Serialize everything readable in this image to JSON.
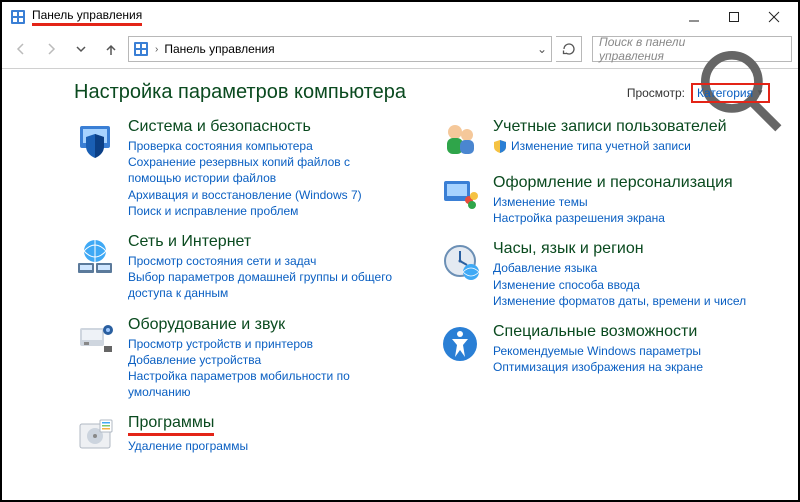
{
  "window": {
    "title": "Панель управления"
  },
  "breadcrumb": {
    "label": "Панель управления"
  },
  "search": {
    "placeholder": "Поиск в панели управления"
  },
  "heading": "Настройка параметров компьютера",
  "viewby": {
    "label": "Просмотр:",
    "value": "Категория"
  },
  "left": [
    {
      "title": "Система и безопасность",
      "links": [
        "Проверка состояния компьютера",
        "Сохранение резервных копий файлов с помощью истории файлов",
        "Архивация и восстановление (Windows 7)",
        "Поиск и исправление проблем"
      ]
    },
    {
      "title": "Сеть и Интернет",
      "links": [
        "Просмотр состояния сети и задач",
        "Выбор параметров домашней группы и общего доступа к данным"
      ]
    },
    {
      "title": "Оборудование и звук",
      "links": [
        "Просмотр устройств и принтеров",
        "Добавление устройства",
        "Настройка параметров мобильности по умолчанию"
      ]
    },
    {
      "title": "Программы",
      "links": [
        "Удаление программы"
      ]
    }
  ],
  "right": [
    {
      "title": "Учетные записи пользователей",
      "links": [
        "Изменение типа учетной записи"
      ],
      "shield": true
    },
    {
      "title": "Оформление и персонализация",
      "links": [
        "Изменение темы",
        "Настройка разрешения экрана"
      ]
    },
    {
      "title": "Часы, язык и регион",
      "links": [
        "Добавление языка",
        "Изменение способа ввода",
        "Изменение форматов даты, времени и чисел"
      ]
    },
    {
      "title": "Специальные возможности",
      "links": [
        "Рекомендуемые Windows параметры",
        "Оптимизация изображения на экране"
      ]
    }
  ]
}
